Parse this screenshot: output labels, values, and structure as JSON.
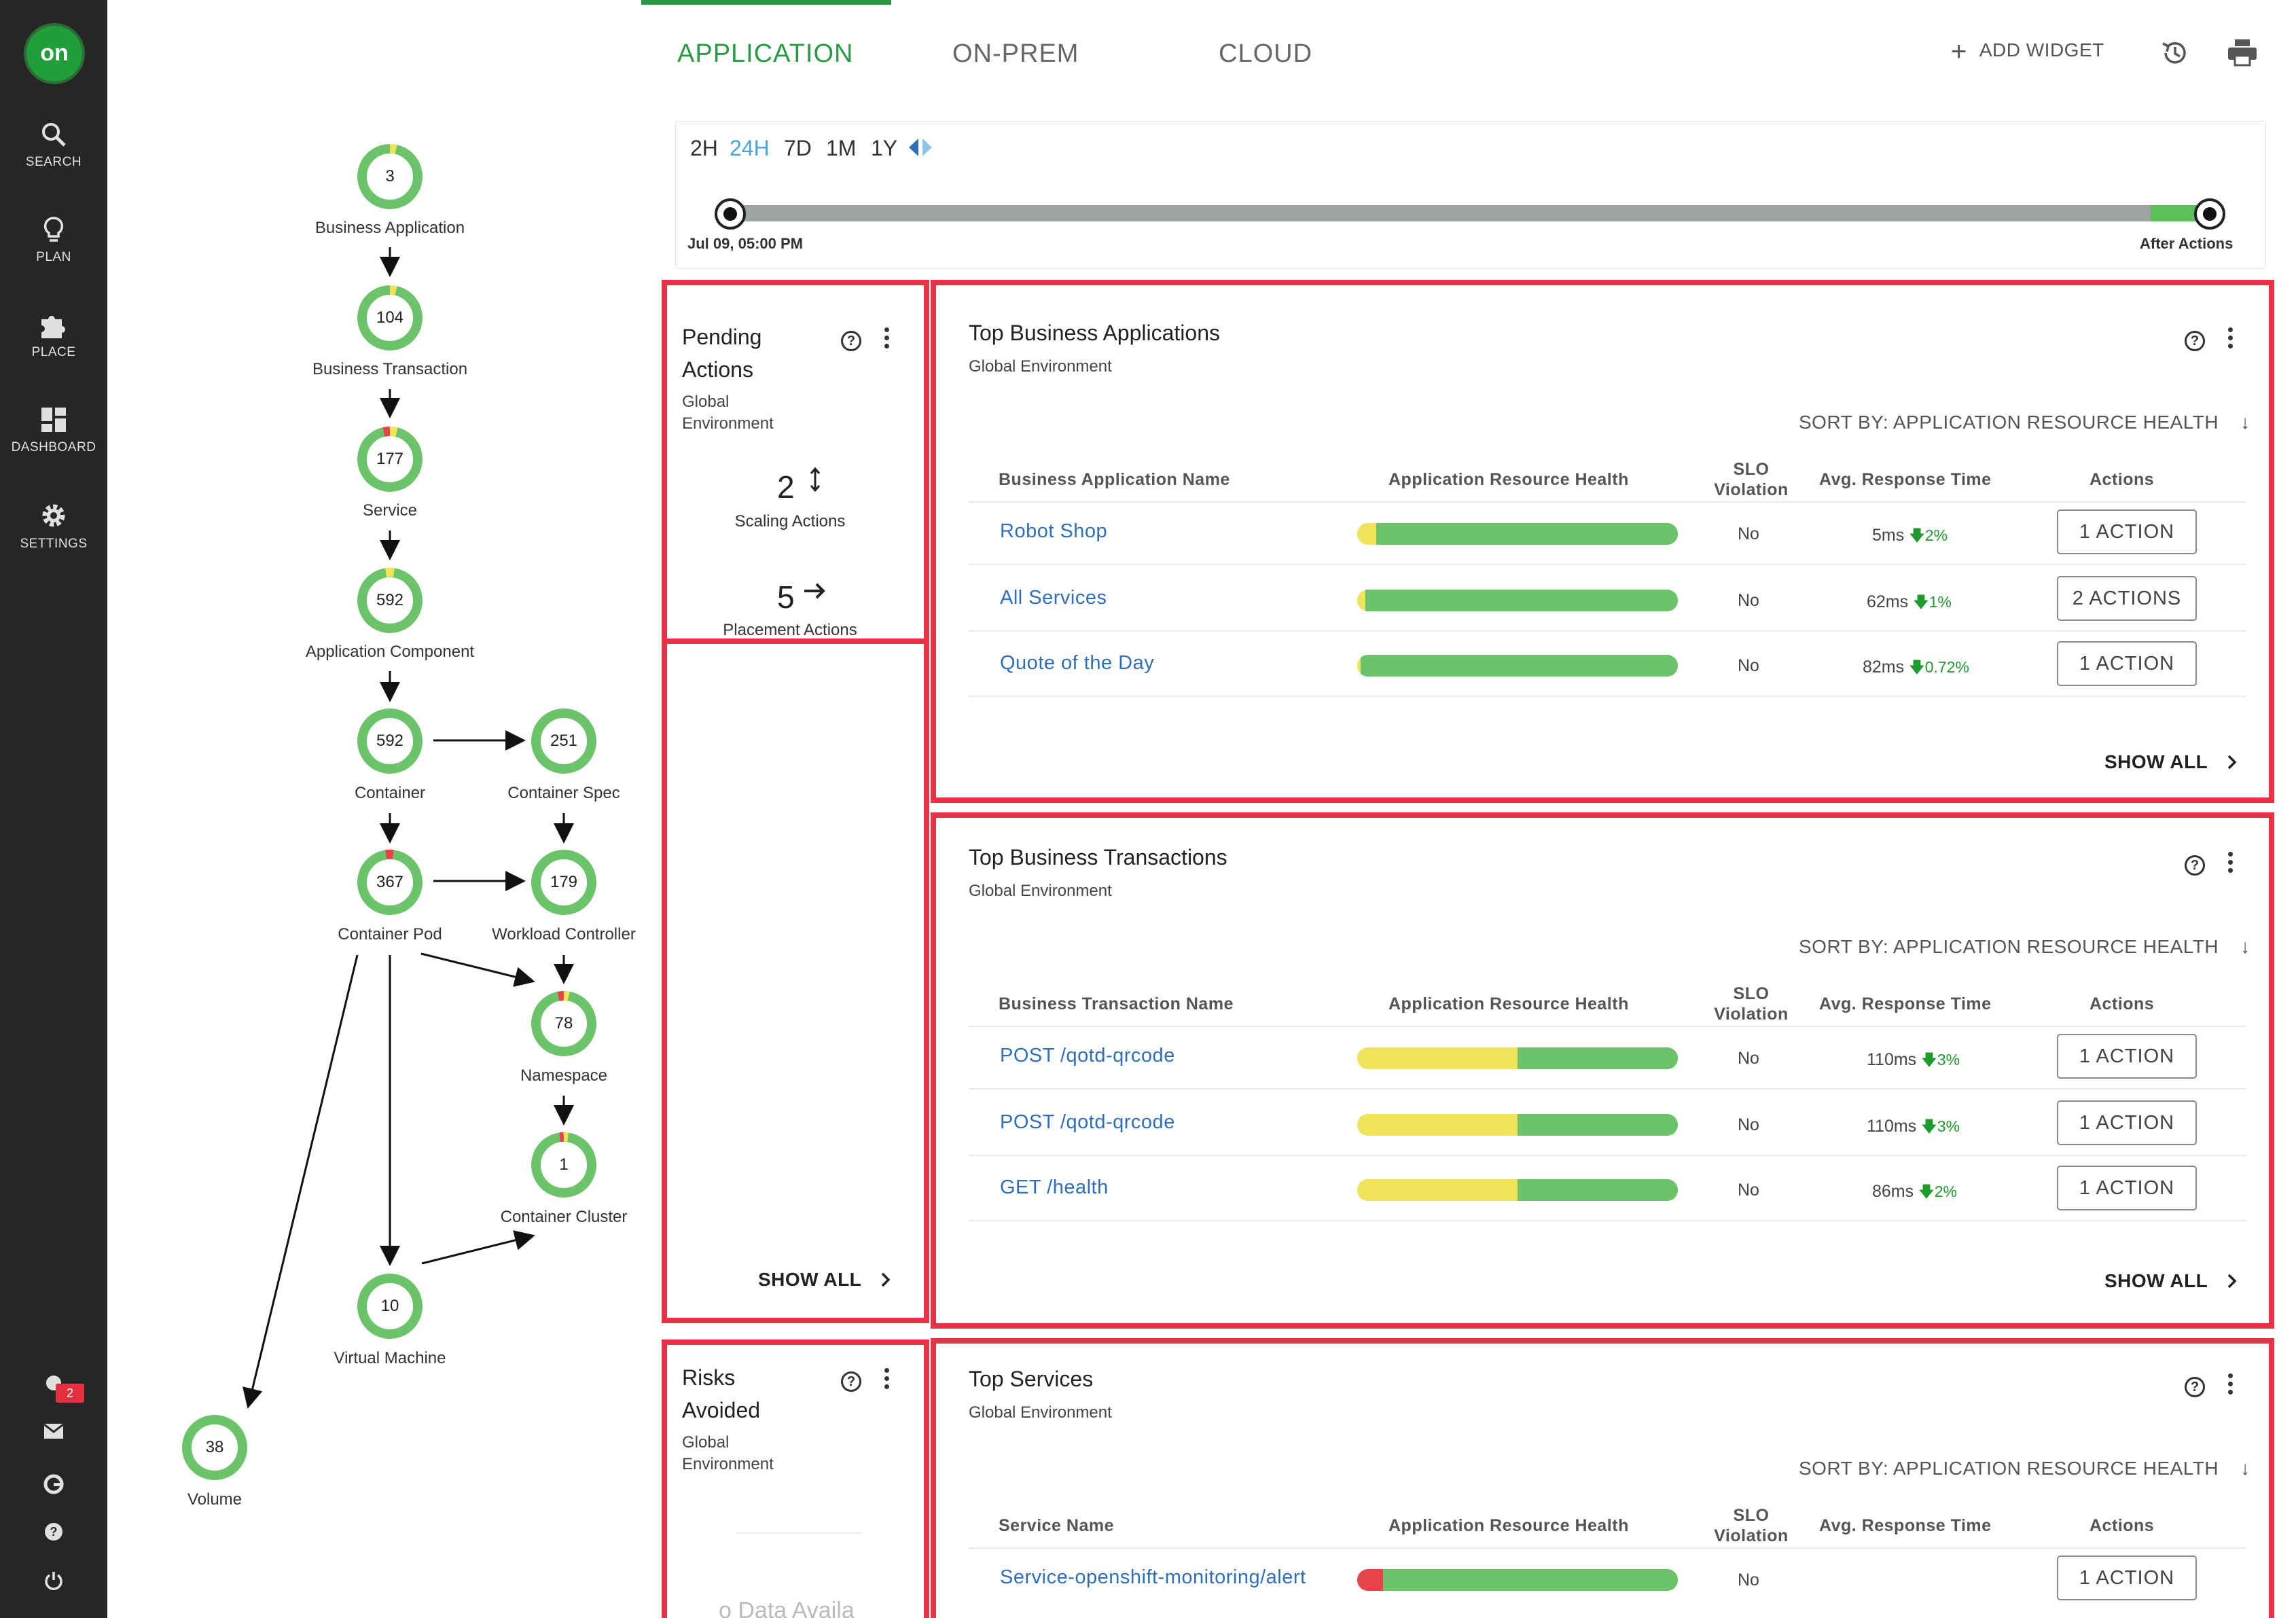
{
  "nav": {
    "logo": "on",
    "items": [
      {
        "label": "SEARCH",
        "icon": "search-icon"
      },
      {
        "label": "PLAN",
        "icon": "lightbulb-icon"
      },
      {
        "label": "PLACE",
        "icon": "puzzle-icon"
      },
      {
        "label": "DASHBOARD",
        "icon": "dashboard-icon"
      },
      {
        "label": "SETTINGS",
        "icon": "gear-icon"
      }
    ],
    "notification_count": "2"
  },
  "topology": {
    "nodes": [
      {
        "count": "3",
        "label": "Business Application"
      },
      {
        "count": "104",
        "label": "Business Transaction"
      },
      {
        "count": "177",
        "label": "Service"
      },
      {
        "count": "592",
        "label": "Application Component"
      },
      {
        "count": "592",
        "label": "Container"
      },
      {
        "count": "251",
        "label": "Container Spec"
      },
      {
        "count": "367",
        "label": "Container Pod"
      },
      {
        "count": "179",
        "label": "Workload Controller"
      },
      {
        "count": "78",
        "label": "Namespace"
      },
      {
        "count": "1",
        "label": "Container Cluster"
      },
      {
        "count": "10",
        "label": "Virtual Machine"
      },
      {
        "count": "38",
        "label": "Volume"
      }
    ]
  },
  "tabs": [
    "APPLICATION",
    "ON-PREM",
    "CLOUD"
  ],
  "toolbar": {
    "add_widget": "ADD WIDGET"
  },
  "timerange": {
    "options": [
      "2H",
      "24H",
      "7D",
      "1M",
      "1Y"
    ],
    "selected": "24H",
    "start_label": "Jul 09, 05:00 PM",
    "end_label": "After Actions"
  },
  "pending": {
    "title_line1": "Pending",
    "title_line2": "Actions",
    "sub_line1": "Global",
    "sub_line2": "Environment",
    "scaling_count": "2",
    "scaling_label": "Scaling Actions",
    "placement_count": "5",
    "placement_label": "Placement Actions",
    "show_all": "SHOW ALL"
  },
  "risks": {
    "title_line1": "Risks",
    "title_line2": "Avoided",
    "sub_line1": "Global",
    "sub_line2": "Environment",
    "empty_text": "o Data Availa"
  },
  "columns": {
    "health": "Application Resource Health",
    "slo_line1": "SLO",
    "slo_line2": "Violation",
    "response": "Avg. Response Time",
    "actions": "Actions"
  },
  "apps": {
    "title": "Top Business Applications",
    "sub": "Global Environment",
    "sort": "SORT BY: APPLICATION RESOURCE HEALTH",
    "name_col": "Business Application Name",
    "rows": [
      {
        "name": "Robot Shop",
        "slo": "No",
        "resp": "5ms",
        "trend": "2%",
        "action": "1 ACTION"
      },
      {
        "name": "All Services",
        "slo": "No",
        "resp": "62ms",
        "trend": "1%",
        "action": "2 ACTIONS"
      },
      {
        "name": "Quote of the Day",
        "slo": "No",
        "resp": "82ms",
        "trend": "0.72%",
        "action": "1 ACTION"
      }
    ],
    "show_all": "SHOW ALL"
  },
  "transactions": {
    "title": "Top Business Transactions",
    "sub": "Global Environment",
    "sort": "SORT BY: APPLICATION RESOURCE HEALTH",
    "name_col": "Business Transaction Name",
    "rows": [
      {
        "name": "POST /qotd-qrcode",
        "slo": "No",
        "resp": "110ms",
        "trend": "3%",
        "action": "1 ACTION"
      },
      {
        "name": "POST /qotd-qrcode",
        "slo": "No",
        "resp": "110ms",
        "trend": "3%",
        "action": "1 ACTION"
      },
      {
        "name": "GET /health",
        "slo": "No",
        "resp": "86ms",
        "trend": "2%",
        "action": "1 ACTION"
      }
    ],
    "show_all": "SHOW ALL"
  },
  "services": {
    "title": "Top Services",
    "sub": "Global Environment",
    "sort": "SORT BY: APPLICATION RESOURCE HEALTH",
    "name_col": "Service Name",
    "rows": [
      {
        "name": "Service-openshift-monitoring/alert",
        "slo": "No",
        "action": "1 ACTION"
      }
    ]
  },
  "health_bars": {
    "apps": [
      {
        "yellow": 0.06,
        "red": 0
      },
      {
        "yellow": 0.025,
        "red": 0
      },
      {
        "yellow": 0.01,
        "red": 0
      }
    ],
    "transactions": [
      {
        "yellow": 0.5,
        "red": 0
      },
      {
        "yellow": 0.5,
        "red": 0
      },
      {
        "yellow": 0.5,
        "red": 0
      }
    ],
    "services": [
      {
        "yellow": 0,
        "red": 0.08
      }
    ]
  },
  "colors": {
    "accent_green": "#2a9a44",
    "highlight_red": "#e83345",
    "link_blue": "#2f6fba"
  }
}
